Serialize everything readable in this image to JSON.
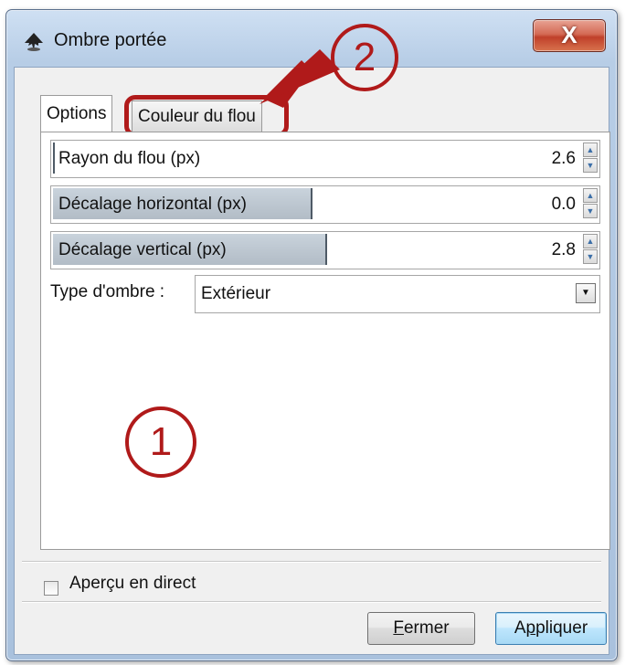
{
  "page_caption": "",
  "window": {
    "title": "Ombre portée",
    "close_label": "X"
  },
  "tabs": [
    {
      "label": "Options"
    },
    {
      "label": "Couleur du flou"
    }
  ],
  "fields": [
    {
      "label": "Rayon du flou (px)",
      "value": "2.6",
      "fill_fraction": 0.0
    },
    {
      "label": "Décalage horizontal (px)",
      "value": "0.0",
      "fill_fraction": 0.5
    },
    {
      "label": "Décalage vertical (px)",
      "value": "2.8",
      "fill_fraction": 0.51
    }
  ],
  "shadow_type": {
    "label": "Type d'ombre :",
    "value": "Extérieur"
  },
  "annotations": {
    "marker_1": "1",
    "marker_2": "2",
    "color": "#b01a1a"
  },
  "live_preview": {
    "label": "Aperçu en direct",
    "checked": false
  },
  "buttons": {
    "close_accel": "F",
    "close_rest": "ermer",
    "apply_pre": "A",
    "apply_accel": "p",
    "apply_rest": "pliquer"
  }
}
